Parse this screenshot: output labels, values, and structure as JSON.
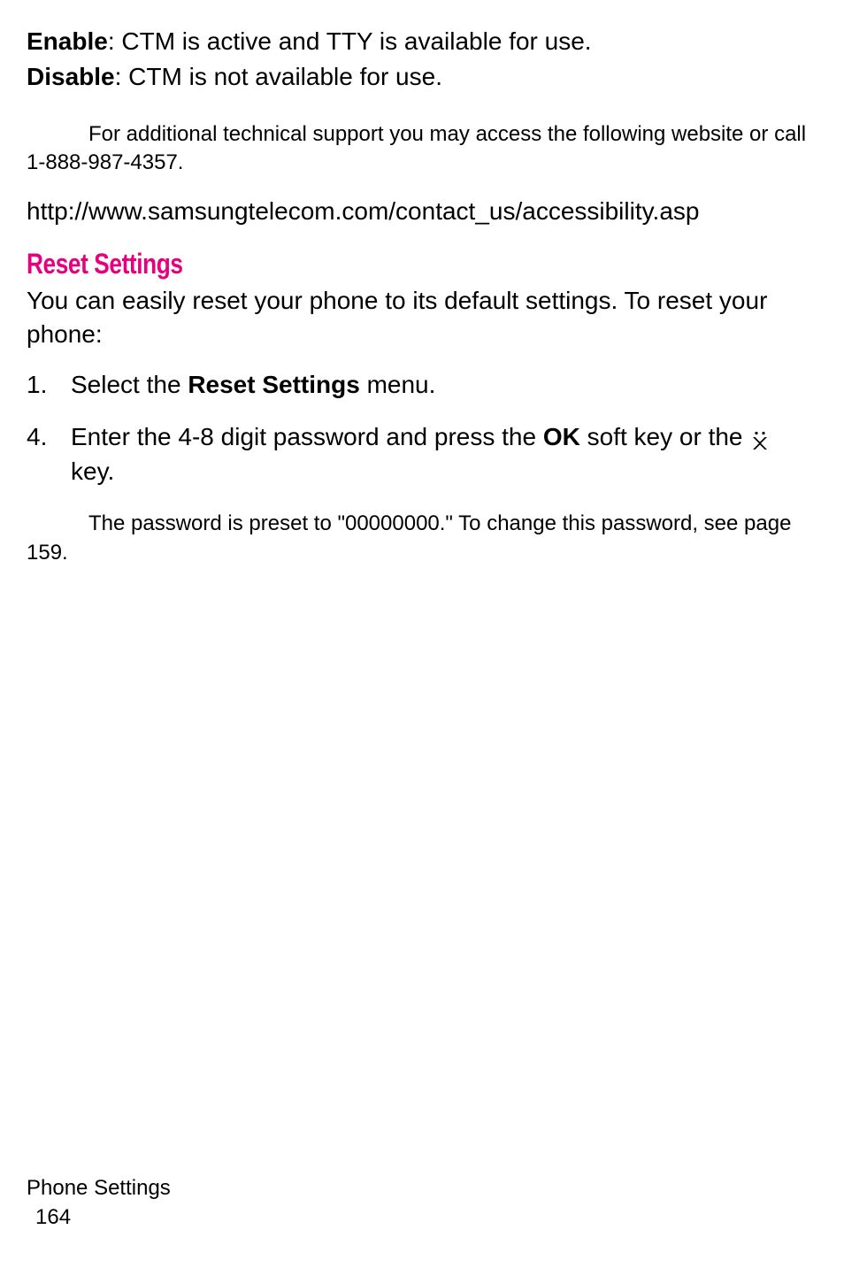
{
  "definitions": {
    "enable_label": "Enable",
    "enable_text": ":  CTM is active and TTY is available for use.",
    "disable_label": "Disable",
    "disable_text": ": CTM is not available for use."
  },
  "support_note": "For additional technical support you may access the following website or call 1-888-987-4357.",
  "url": "http://www.samsungtelecom.com/contact_us/accessibility.asp",
  "section": {
    "heading": "Reset Settings",
    "intro": "You can easily reset your phone to its default settings. To reset your phone:"
  },
  "steps": [
    {
      "number": "1.",
      "prefix": "Select the ",
      "bold": "Reset Settings",
      "suffix": " menu."
    },
    {
      "number": "4.",
      "prefix": "Enter the 4-8 digit password and press the ",
      "bold": "OK",
      "suffix": " soft key or the ",
      "has_icon": true,
      "icon_name": "x-key-icon",
      "after_icon": " key."
    }
  ],
  "password_note": "The password is preset to \"00000000.\" To change this password, see page 159.",
  "footer": {
    "section": "Phone Settings",
    "page": "164"
  }
}
